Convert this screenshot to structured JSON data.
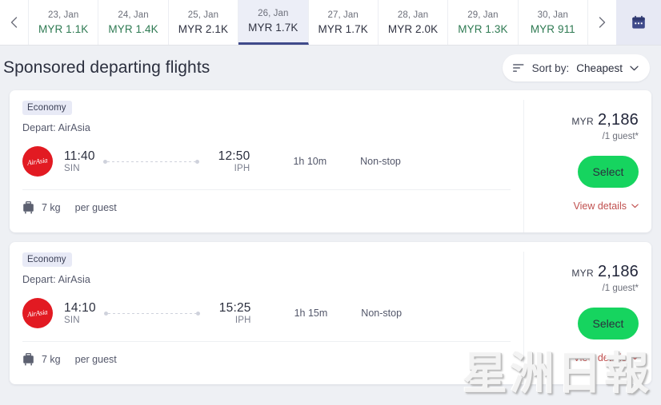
{
  "date_strip": {
    "prev_label": "‹",
    "next_label": "›",
    "calendar_icon": "calendar-icon",
    "dates": [
      {
        "day": "23, Jan",
        "price": "MYR 1.1K",
        "tone": "green",
        "selected": false
      },
      {
        "day": "24, Jan",
        "price": "MYR 1.4K",
        "tone": "green",
        "selected": false
      },
      {
        "day": "25, Jan",
        "price": "MYR 2.1K",
        "tone": "dark",
        "selected": false
      },
      {
        "day": "26, Jan",
        "price": "MYR 1.7K",
        "tone": "dark",
        "selected": true
      },
      {
        "day": "27, Jan",
        "price": "MYR 1.7K",
        "tone": "dark",
        "selected": false
      },
      {
        "day": "28, Jan",
        "price": "MYR 2.0K",
        "tone": "dark",
        "selected": false
      },
      {
        "day": "29, Jan",
        "price": "MYR 1.3K",
        "tone": "green",
        "selected": false
      },
      {
        "day": "30, Jan",
        "price": "MYR 911",
        "tone": "green",
        "selected": false
      }
    ]
  },
  "header": {
    "title": "Sponsored departing flights",
    "sort": {
      "icon": "sort-lines-icon",
      "label": "Sort by:",
      "value": "Cheapest",
      "chevron": "chevron-down-icon"
    }
  },
  "flights": [
    {
      "cabin_badge": "Economy",
      "depart_label": "Depart: AirAsia",
      "airline_logo_text": "AirAsia",
      "depart_time": "11:40",
      "depart_code": "SIN",
      "arrive_time": "12:50",
      "arrive_code": "IPH",
      "duration": "1h 10m",
      "stops": "Non-stop",
      "baggage_weight": "7 kg",
      "baggage_scope": "per guest",
      "currency": "MYR",
      "amount": "2,186",
      "guests": "/1 guest*",
      "select_label": "Select",
      "view_details_label": "View details"
    },
    {
      "cabin_badge": "Economy",
      "depart_label": "Depart: AirAsia",
      "airline_logo_text": "AirAsia",
      "depart_time": "14:10",
      "depart_code": "SIN",
      "arrive_time": "15:25",
      "arrive_code": "IPH",
      "duration": "1h 15m",
      "stops": "Non-stop",
      "baggage_weight": "7 kg",
      "baggage_scope": "per guest",
      "currency": "MYR",
      "amount": "2,186",
      "guests": "/1 guest*",
      "select_label": "Select",
      "view_details_label": "View details"
    }
  ],
  "watermark": {
    "text": "星洲日報"
  },
  "colors": {
    "accent_select": "#16d45f",
    "price_green": "#2e7a52",
    "selected_tab_border": "#3f4a8a",
    "badge_bg": "#e8eaf6",
    "view_details": "#c0504f",
    "airline_red": "#e21a22"
  }
}
